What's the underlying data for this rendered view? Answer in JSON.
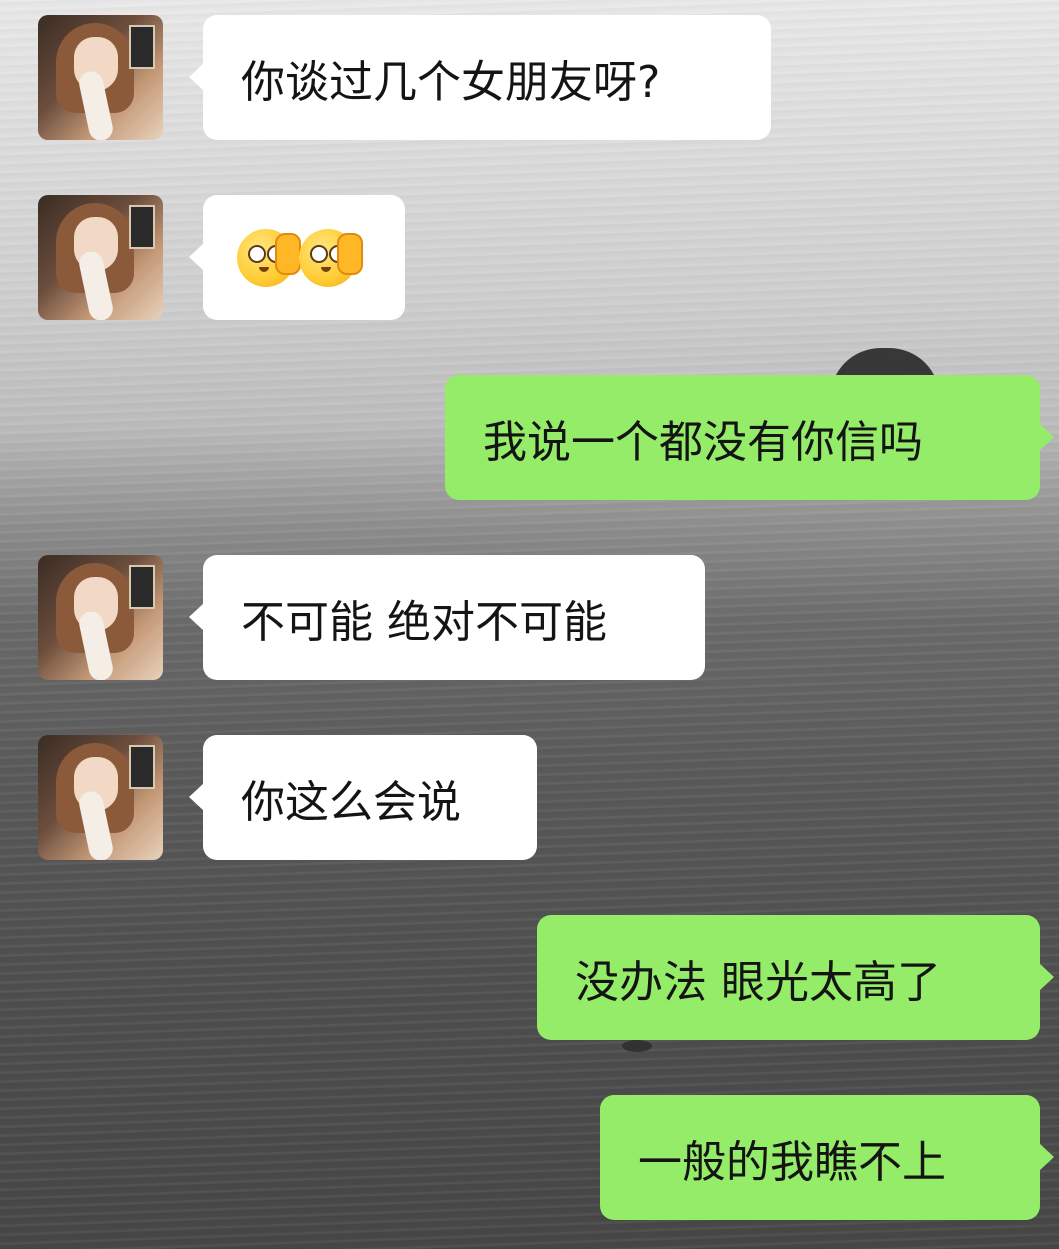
{
  "chat": {
    "messages": [
      {
        "side": "in",
        "text": "你谈过几个女朋友呀?"
      },
      {
        "side": "in",
        "emoji": [
          "pleading-hand-on-cheek-emoji",
          "pleading-hand-on-cheek-emoji"
        ]
      },
      {
        "side": "out",
        "text": "我说一个都没有你信吗"
      },
      {
        "side": "in",
        "text": "不可能 绝对不可能"
      },
      {
        "side": "in",
        "text": "你这么会说"
      },
      {
        "side": "out",
        "text": "没办法 眼光太高了"
      },
      {
        "side": "out",
        "text": "一般的我瞧不上"
      }
    ]
  },
  "colors": {
    "incoming_bubble": "#ffffff",
    "outgoing_bubble": "#95ec69",
    "text": "#141414"
  }
}
